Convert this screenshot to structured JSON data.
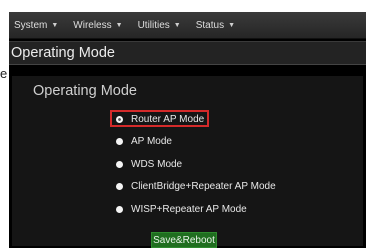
{
  "edge_label": "e",
  "menu": [
    {
      "label": "System"
    },
    {
      "label": "Wireless"
    },
    {
      "label": "Utilities"
    },
    {
      "label": "Status"
    }
  ],
  "page_title": "Operating Mode",
  "section_title": "Operating Mode",
  "modes": [
    {
      "label": "Router AP Mode",
      "selected": true
    },
    {
      "label": "AP Mode",
      "selected": false
    },
    {
      "label": "WDS Mode",
      "selected": false
    },
    {
      "label": "ClientBridge+Repeater AP Mode",
      "selected": false
    },
    {
      "label": "WISP+Repeater AP Mode",
      "selected": false
    }
  ],
  "save_label": "Save&Reboot",
  "colors": {
    "highlight": "#d42a2a",
    "button": "#1f6e1f",
    "background": "#000000"
  }
}
